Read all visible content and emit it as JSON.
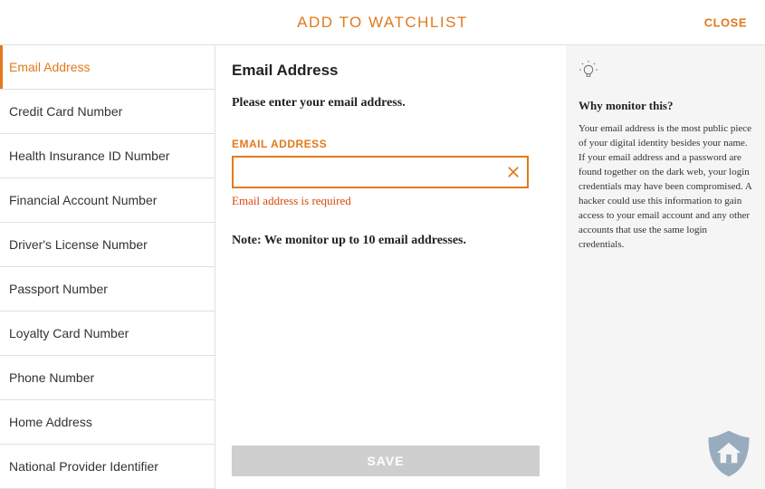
{
  "header": {
    "title": "ADD TO WATCHLIST",
    "close": "CLOSE"
  },
  "sidebar": {
    "items": [
      {
        "label": "Email Address",
        "active": true
      },
      {
        "label": "Credit Card Number",
        "active": false
      },
      {
        "label": "Health Insurance ID Number",
        "active": false
      },
      {
        "label": "Financial Account Number",
        "active": false
      },
      {
        "label": "Driver's License Number",
        "active": false
      },
      {
        "label": "Passport Number",
        "active": false
      },
      {
        "label": "Loyalty Card Number",
        "active": false
      },
      {
        "label": "Phone Number",
        "active": false
      },
      {
        "label": "Home Address",
        "active": false
      },
      {
        "label": "National Provider Identifier",
        "active": false
      }
    ]
  },
  "main": {
    "title": "Email Address",
    "subtitle": "Please enter your email address.",
    "field_label": "EMAIL ADDRESS",
    "input_value": "",
    "error": "Email address is required",
    "note": "Note: We monitor up to 10 email addresses.",
    "save_label": "SAVE"
  },
  "info": {
    "title": "Why monitor this?",
    "body": "Your email address is the most public piece of your digital identity besides your name. If your email address and a password are found together on the dark web, your login credentials may have been compromised. A hacker could use this information to gain access to your email account and any other accounts that use the same login credentials."
  },
  "colors": {
    "accent": "#e17a1c"
  }
}
